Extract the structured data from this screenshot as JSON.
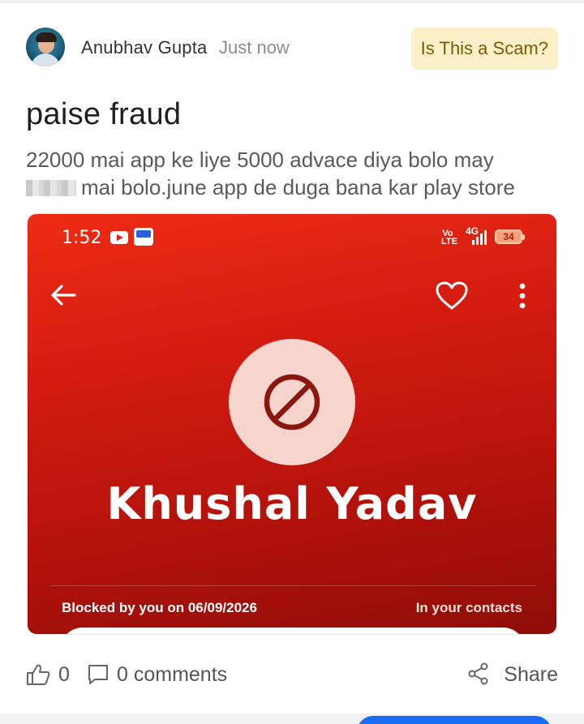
{
  "post": {
    "author": "Anubhav Gupta",
    "time": "Just now",
    "badge": "Is This a Scam?",
    "title": "paise fraud",
    "body_line1": "22000 mai app ke liye 5000 advace diya bolo may",
    "body_line2": "mai bolo.june app de duga bana kar play store"
  },
  "screenshot": {
    "status_time": "1:52",
    "network_volte": "Vo LTE",
    "network_type": "4G",
    "battery": "34",
    "contact_name": "Khushal Yadav",
    "blocked_text": "Blocked by you on 06/09/2026",
    "contacts_text": "In your contacts",
    "icons": [
      "back-arrow-icon",
      "heart-icon",
      "more-vertical-icon",
      "block-icon",
      "youtube-icon"
    ]
  },
  "actions": {
    "likes": "0",
    "comments": "0 comments",
    "share": "Share"
  },
  "colors": {
    "badge_bg": "#fdf0c8",
    "badge_text": "#7a5a05",
    "card_red": "#d11b0f",
    "accent_blue": "#1a6cf2"
  }
}
